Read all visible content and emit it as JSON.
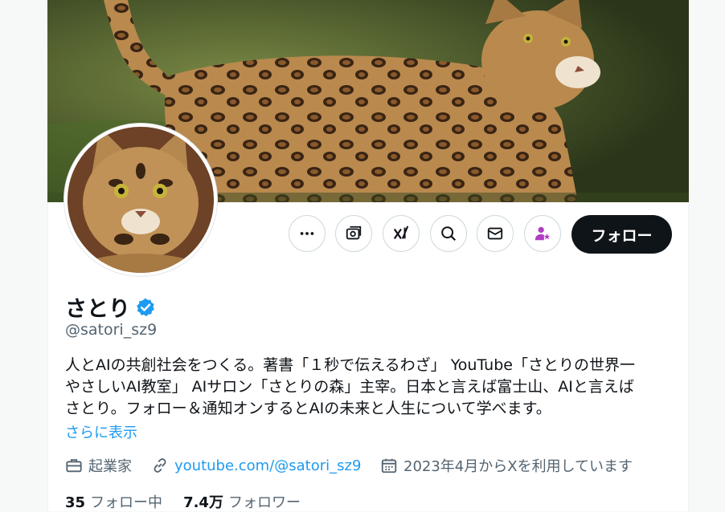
{
  "colors": {
    "accent": "#1d9bf0",
    "text_primary": "#0f1419",
    "text_secondary": "#536471",
    "follow_bg": "#0f1419",
    "subscribe_icon": "#b03ec4"
  },
  "actions": {
    "more_icon": "more-icon",
    "grok_icon": "grok-icon",
    "xai_icon": "xai-icon",
    "search_icon": "search-icon",
    "message_icon": "mail-icon",
    "subscribe_icon": "subscribe-icon",
    "follow_label": "フォロー"
  },
  "profile": {
    "display_name": "さとり",
    "handle": "@satori_sz9",
    "bio_lines": [
      "人とAIの共創社会をつくる。著書「１秒で伝えるわざ」 YouTube「さとりの世界一",
      "やさしいAI教室」 AIサロン「さとりの森」主宰。日本と言えば富士山、AIと言えば",
      "さとり。フォロー＆通知オンするとAIの未来と人生について学べます。"
    ],
    "show_more": "さらに表示",
    "profession": "起業家",
    "website": "youtube.com/@satori_sz9",
    "joined": "2023年4月からXを利用しています"
  },
  "stats": {
    "following_count": "35",
    "following_label": "フォロー中",
    "followers_count": "7.4万",
    "followers_label": "フォロワー"
  }
}
